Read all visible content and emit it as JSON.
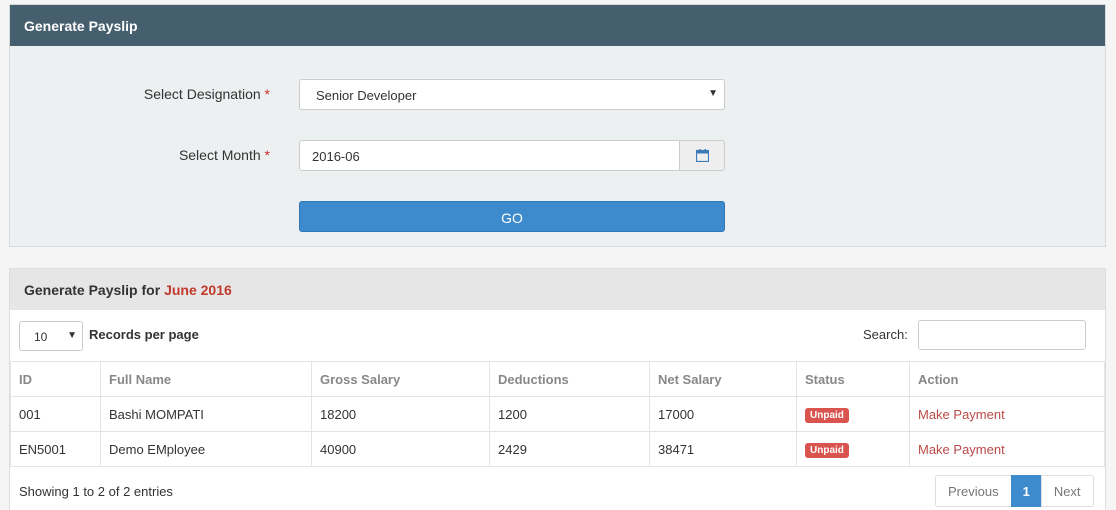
{
  "form_panel": {
    "title": "Generate Payslip",
    "designation_label": "Select Designation",
    "designation_value": "Senior Developer",
    "month_label": "Select Month",
    "month_value": "2016-06",
    "required_mark": "*",
    "go_label": "GO"
  },
  "list_panel": {
    "title_prefix": "Generate Payslip for",
    "title_period": "June 2016",
    "page_length": "10",
    "records_per_page_label": "Records per page",
    "search_label": "Search:",
    "search_value": "",
    "columns": [
      "ID",
      "Full Name",
      "Gross Salary",
      "Deductions",
      "Net Salary",
      "Status",
      "Action"
    ],
    "rows": [
      {
        "id": "001",
        "name": "Bashi MOMPATI",
        "gross": "18200",
        "deductions": "1200",
        "net": "17000",
        "status": "Unpaid",
        "action": "Make Payment"
      },
      {
        "id": "EN5001",
        "name": "Demo EMployee",
        "gross": "40900",
        "deductions": "2429",
        "net": "38471",
        "status": "Unpaid",
        "action": "Make Payment"
      }
    ],
    "info": "Showing 1 to 2 of 2 entries",
    "pagination": {
      "previous": "Previous",
      "current": "1",
      "next": "Next"
    }
  },
  "colors": {
    "header_bg": "#465f6e",
    "primary": "#3d8bcc",
    "danger": "#d9534f",
    "link": "#b94a48",
    "highlight": "#c0392b"
  },
  "icons": {
    "date_picker": "calendar-icon",
    "dropdown": "caret-down-icon"
  }
}
